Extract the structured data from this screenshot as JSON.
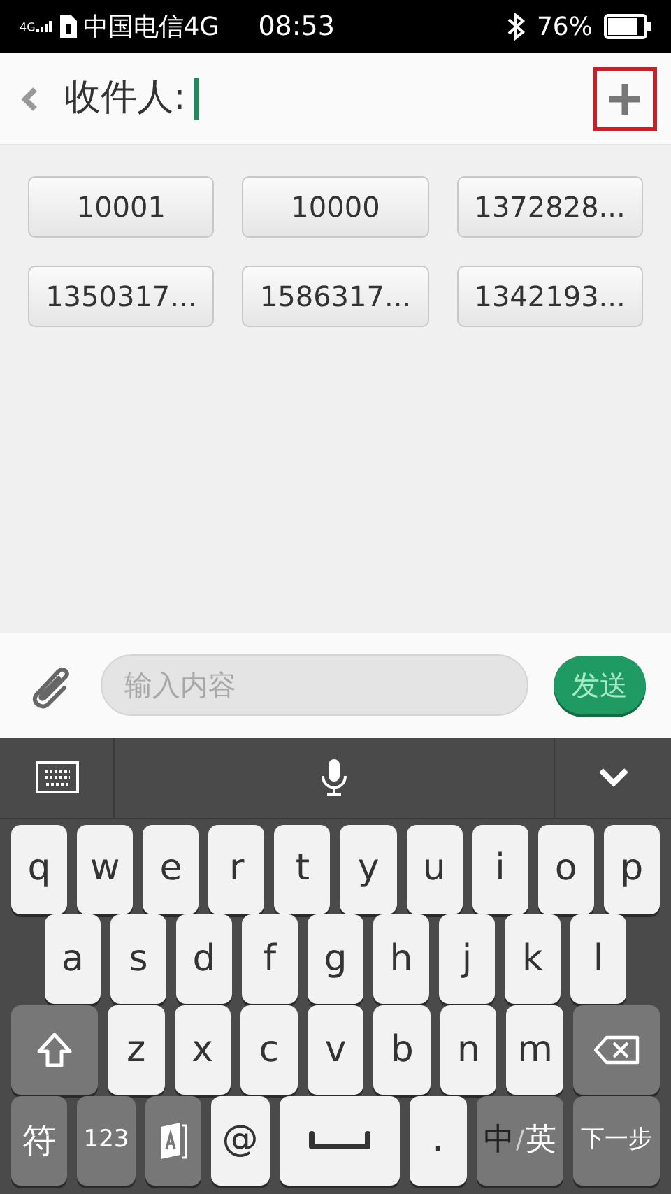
{
  "status_bar": {
    "network": "4G",
    "carrier": "中国电信4G",
    "time": "08:53",
    "battery": "76%"
  },
  "header": {
    "label": "收件人:"
  },
  "recipients": [
    "10001",
    "10000",
    "1372828...",
    "1350317...",
    "1586317...",
    "1342193..."
  ],
  "compose": {
    "placeholder": "输入内容",
    "send": "发送"
  },
  "keyboard": {
    "rows": [
      {
        "keys": [
          {
            "kind": "letter",
            "label": "q"
          },
          {
            "kind": "letter",
            "label": "w"
          },
          {
            "kind": "letter",
            "label": "e"
          },
          {
            "kind": "letter",
            "label": "r"
          },
          {
            "kind": "letter",
            "label": "t"
          },
          {
            "kind": "letter",
            "label": "y"
          },
          {
            "kind": "letter",
            "label": "u"
          },
          {
            "kind": "letter",
            "label": "i"
          },
          {
            "kind": "letter",
            "label": "o"
          },
          {
            "kind": "letter",
            "label": "p"
          }
        ]
      },
      {
        "keys": [
          {
            "kind": "letter",
            "label": "a"
          },
          {
            "kind": "letter",
            "label": "s"
          },
          {
            "kind": "letter",
            "label": "d"
          },
          {
            "kind": "letter",
            "label": "f"
          },
          {
            "kind": "letter",
            "label": "g"
          },
          {
            "kind": "letter",
            "label": "h"
          },
          {
            "kind": "letter",
            "label": "j"
          },
          {
            "kind": "letter",
            "label": "k"
          },
          {
            "kind": "letter",
            "label": "l"
          }
        ]
      },
      {
        "keys": [
          {
            "kind": "shift"
          },
          {
            "kind": "letter",
            "label": "z"
          },
          {
            "kind": "letter",
            "label": "x"
          },
          {
            "kind": "letter",
            "label": "c"
          },
          {
            "kind": "letter",
            "label": "v"
          },
          {
            "kind": "letter",
            "label": "b"
          },
          {
            "kind": "letter",
            "label": "n"
          },
          {
            "kind": "letter",
            "label": "m"
          },
          {
            "kind": "backspace"
          }
        ]
      },
      {
        "keys": [
          {
            "kind": "function",
            "label": "符"
          },
          {
            "kind": "function",
            "label": "123"
          },
          {
            "kind": "book"
          },
          {
            "kind": "letter",
            "label": "@"
          },
          {
            "kind": "space"
          },
          {
            "kind": "letter",
            "label": "."
          },
          {
            "kind": "lang",
            "separator": "/",
            "options": [
              {
                "label": "中",
                "selected": false
              },
              {
                "label": "英",
                "selected": true
              }
            ]
          },
          {
            "kind": "function",
            "label": "下一步"
          }
        ]
      }
    ]
  }
}
